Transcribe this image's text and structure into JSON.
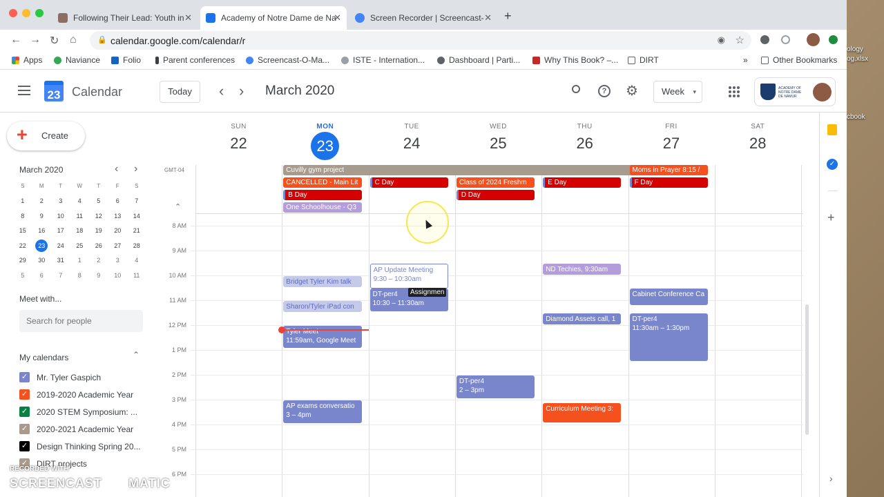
{
  "browser": {
    "tabs": [
      {
        "title": "Following Their Lead: Youth in",
        "color": "#8d6e63"
      },
      {
        "title": "Academy of Notre Dame de Na",
        "color": "#1a73e8"
      },
      {
        "title": "Screen Recorder | Screencast-",
        "color": "#4285f4"
      }
    ],
    "url": "calendar.google.com/calendar/r",
    "bookmarks": [
      {
        "label": "Apps",
        "color": "#ea4335"
      },
      {
        "label": "Naviance",
        "color": "#34a853"
      },
      {
        "label": "Folio",
        "color": "#1565c0"
      },
      {
        "label": "Parent conferences",
        "color": "#3c4043"
      },
      {
        "label": "Screencast-O-Ma...",
        "color": "#4285f4"
      },
      {
        "label": "ISTE - Internation...",
        "color": "#9aa0a6"
      },
      {
        "label": "Dashboard | Parti...",
        "color": "#5f6368"
      },
      {
        "label": "Why This Book? –...",
        "color": "#c62828"
      },
      {
        "label": "DIRT",
        "color": "#9aa0a6"
      }
    ],
    "other_bookmarks": "Other Bookmarks",
    "more": "»"
  },
  "desktop": {
    "file1": "ology",
    "file2": "og.xlsx",
    "file3": "cbook"
  },
  "header": {
    "app_logo_day": "23",
    "app_name": "Calendar",
    "today_label": "Today",
    "prev": "‹",
    "next": "›",
    "month": "March 2020",
    "view": "Week",
    "view_caret": "▾",
    "org_name": "ACADEMY OF NOTRE DAME DE NAMUR"
  },
  "sidebar": {
    "create_label": "Create",
    "mini_month": "March 2020",
    "weekdays": [
      "S",
      "M",
      "T",
      "W",
      "T",
      "F",
      "S"
    ],
    "weeks": [
      [
        "1",
        "2",
        "3",
        "4",
        "5",
        "6",
        "7"
      ],
      [
        "8",
        "9",
        "10",
        "11",
        "12",
        "13",
        "14"
      ],
      [
        "15",
        "16",
        "17",
        "18",
        "19",
        "20",
        "21"
      ],
      [
        "22",
        "23",
        "24",
        "25",
        "26",
        "27",
        "28"
      ],
      [
        "29",
        "30",
        "31",
        "1",
        "2",
        "3",
        "4"
      ],
      [
        "5",
        "6",
        "7",
        "8",
        "9",
        "10",
        "11"
      ]
    ],
    "selected_day": "23",
    "meet_with": "Meet with...",
    "search_placeholder": "Search for people",
    "my_calendars": "My calendars",
    "calendars": [
      {
        "name": "Mr. Tyler Gaspich",
        "color": "#7986cb"
      },
      {
        "name": "2019-2020 Academic Year",
        "color": "#f4511e"
      },
      {
        "name": "2020 STEM Symposium: ...",
        "color": "#0b8043"
      },
      {
        "name": "2020-2021 Academic Year",
        "color": "#a79b8e"
      },
      {
        "name": "Design Thinking Spring 20...",
        "color": "#000000"
      },
      {
        "name": "DIRT projects",
        "color": "#a79b8e"
      }
    ]
  },
  "watermark": {
    "line1": "RECORDED WITH",
    "line2a": "SCREENCAST",
    "line2b": "MATIC"
  },
  "week": {
    "timezone": "GMT-04",
    "days": [
      {
        "name": "SUN",
        "num": "22"
      },
      {
        "name": "MON",
        "num": "23",
        "today": true
      },
      {
        "name": "TUE",
        "num": "24"
      },
      {
        "name": "WED",
        "num": "25"
      },
      {
        "name": "THU",
        "num": "26"
      },
      {
        "name": "FRI",
        "num": "27"
      },
      {
        "name": "SAT",
        "num": "28"
      }
    ],
    "hours": [
      "8 AM",
      "9 AM",
      "10 AM",
      "11 AM",
      "12 PM",
      "1 PM",
      "2 PM",
      "3 PM",
      "4 PM",
      "5 PM",
      "6 PM"
    ]
  },
  "allday_events": [
    {
      "title": "Cuvilly gym project",
      "color": "#a79b8e"
    },
    {
      "title": "Moms in Prayer 8:15 /",
      "color": "#f4511e"
    },
    {
      "title": "CANCELLED - Main Lit",
      "color": "#f4511e"
    },
    {
      "title": "C Day",
      "color": "#d50000"
    },
    {
      "title": "Class of 2024 Freshm",
      "color": "#f4511e"
    },
    {
      "title": "E Day",
      "color": "#d50000"
    },
    {
      "title": "F Day",
      "color": "#d50000"
    },
    {
      "title": "B Day",
      "color": "#d50000"
    },
    {
      "title": "D Day",
      "color": "#d50000"
    },
    {
      "title": "One Schoolhouse - Q3",
      "color": "#b39ddb"
    }
  ],
  "timed_events": [
    {
      "title": "AP Update Meeting",
      "time": "9:30 – 10:30am",
      "color": "#ffffff"
    },
    {
      "title": "ND Techies, 9:30am",
      "time": "",
      "color": "#b39ddb"
    },
    {
      "title": "Bridget Tyler Kim talk",
      "time": "",
      "color": "#c5cae9"
    },
    {
      "title": "DT-per4",
      "time": "10:30 – 11:30am",
      "color": "#7986cb"
    },
    {
      "title": "Cabinet Conference Ca",
      "time": "",
      "color": "#7986cb"
    },
    {
      "title": "Sharon/Tyler iPad con",
      "time": "",
      "color": "#c5cae9"
    },
    {
      "title": "Diamond Assets call, 1",
      "time": "",
      "color": "#7986cb"
    },
    {
      "title": "DT-per4",
      "time": "11:30am – 1:30pm",
      "color": "#7986cb"
    },
    {
      "title": "Tyler Meet",
      "time": "11:59am, Google Meet",
      "color": "#7986cb"
    },
    {
      "title": "DT-per4",
      "time": "2 – 3pm",
      "color": "#7986cb"
    },
    {
      "title": "AP exams conversatio",
      "time": "3 – 4pm",
      "color": "#7986cb"
    },
    {
      "title": "Curriculum Meeting 3:",
      "time": "",
      "color": "#f4511e"
    }
  ],
  "tooltip": "Assignmen"
}
